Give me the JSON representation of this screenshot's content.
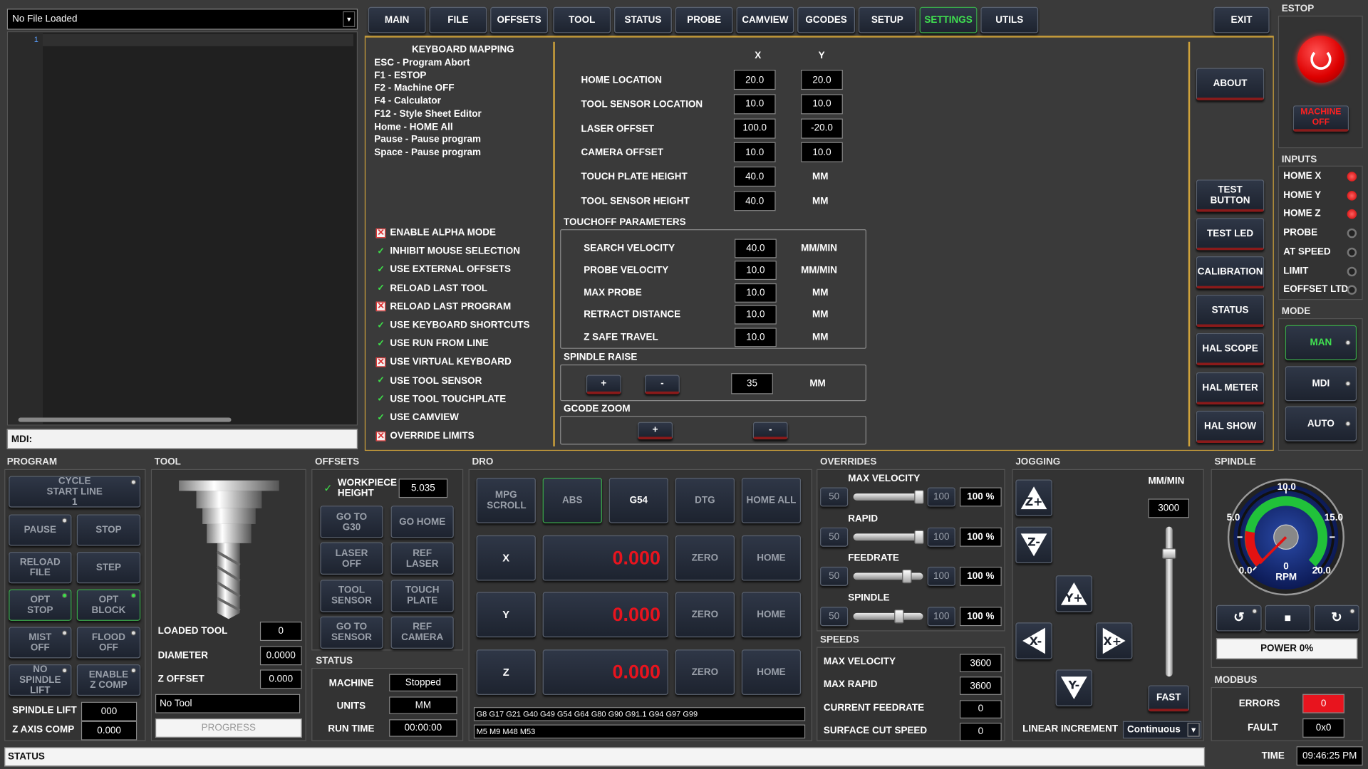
{
  "file_select": "No File Loaded",
  "editor": {
    "line_number": "1",
    "mdi_label": "MDI:"
  },
  "tabs": [
    "MAIN",
    "FILE",
    "OFFSETS",
    "TOOL",
    "STATUS",
    "PROBE",
    "CAMVIEW",
    "GCODES",
    "SETUP",
    "SETTINGS",
    "UTILS"
  ],
  "exit_label": "EXIT",
  "estop": {
    "title": "ESTOP",
    "machine_off": "MACHINE OFF"
  },
  "keyboard": {
    "title": "KEYBOARD MAPPING",
    "lines": [
      "ESC - Program Abort",
      "F1 - ESTOP",
      "F2 - Machine OFF",
      "F4 - Calculator",
      "F12 - Style Sheet Editor",
      "Home - HOME All",
      "Pause - Pause program",
      "Space - Pause program"
    ]
  },
  "options": [
    {
      "label": "ENABLE ALPHA MODE",
      "checked": false
    },
    {
      "label": "INHIBIT MOUSE SELECTION",
      "checked": true
    },
    {
      "label": "USE EXTERNAL OFFSETS",
      "checked": true
    },
    {
      "label": "RELOAD LAST TOOL",
      "checked": true
    },
    {
      "label": "RELOAD LAST PROGRAM",
      "checked": false
    },
    {
      "label": "USE KEYBOARD SHORTCUTS",
      "checked": true
    },
    {
      "label": "USE RUN FROM LINE",
      "checked": true
    },
    {
      "label": "USE VIRTUAL KEYBOARD",
      "checked": false
    },
    {
      "label": "USE TOOL SENSOR",
      "checked": true
    },
    {
      "label": "USE TOOL TOUCHPLATE",
      "checked": true
    },
    {
      "label": "USE CAMVIEW",
      "checked": true
    },
    {
      "label": "OVERRIDE LIMITS",
      "checked": false
    }
  ],
  "settings": {
    "col_x": "X",
    "col_y": "Y",
    "rows": [
      {
        "label": "HOME LOCATION",
        "x": "20.0",
        "y": "20.0"
      },
      {
        "label": "TOOL SENSOR LOCATION",
        "x": "10.0",
        "y": "10.0"
      },
      {
        "label": "LASER OFFSET",
        "x": "100.0",
        "y": "-20.0"
      },
      {
        "label": "CAMERA OFFSET",
        "x": "10.0",
        "y": "10.0"
      },
      {
        "label": "TOUCH PLATE HEIGHT",
        "x": "40.0",
        "y": "MM"
      },
      {
        "label": "TOOL SENSOR HEIGHT",
        "x": "40.0",
        "y": "MM"
      }
    ],
    "touchoff_title": "TOUCHOFF PARAMETERS",
    "touchoff": [
      {
        "label": "SEARCH VELOCITY",
        "value": "40.0",
        "unit": "MM/MIN"
      },
      {
        "label": "PROBE VELOCITY",
        "value": "10.0",
        "unit": "MM/MIN"
      },
      {
        "label": "MAX PROBE",
        "value": "10.0",
        "unit": "MM"
      },
      {
        "label": "RETRACT DISTANCE",
        "value": "10.0",
        "unit": "MM"
      },
      {
        "label": "Z SAFE TRAVEL",
        "value": "10.0",
        "unit": "MM"
      }
    ],
    "spindle_raise_title": "SPINDLE RAISE",
    "spindle_raise_plus": "+",
    "spindle_raise_minus": "-",
    "spindle_raise_value": "35",
    "spindle_raise_unit": "MM",
    "gcode_zoom_title": "GCODE ZOOM",
    "zoom_plus": "+",
    "zoom_minus": "-"
  },
  "side_buttons": [
    "ABOUT",
    "TEST BUTTON",
    "TEST LED",
    "CALIBRATION",
    "STATUS",
    "HAL SCOPE",
    "HAL METER",
    "HAL SHOW"
  ],
  "inputs": {
    "title": "INPUTS",
    "items": [
      "HOME X",
      "HOME Y",
      "HOME Z",
      "PROBE",
      "AT SPEED",
      "LIMIT",
      "EOFFSET LTD"
    ]
  },
  "mode": {
    "title": "MODE",
    "buttons": [
      "MAN",
      "MDI",
      "AUTO"
    ]
  },
  "program": {
    "title": "PROGRAM",
    "cycle_start": "CYCLE START LINE 1",
    "pause": "PAUSE",
    "stop": "STOP",
    "reload": "RELOAD FILE",
    "step": "STEP",
    "opt_stop": "OPT STOP",
    "opt_block": "OPT BLOCK",
    "mist": "MIST OFF",
    "flood": "FLOOD OFF",
    "no_spindle_lift": "NO SPINDLE LIFT",
    "enable_zcomp": "ENABLE Z COMP",
    "spindle_lift_label": "SPINDLE LIFT",
    "spindle_lift_value": "000",
    "zcomp_label": "Z AXIS COMP",
    "zcomp_value": "0.000"
  },
  "tool": {
    "title": "TOOL",
    "loaded_label": "LOADED TOOL",
    "loaded_value": "0",
    "diameter_label": "DIAMETER",
    "diameter_value": "0.0000",
    "zoffset_label": "Z OFFSET",
    "zoffset_value": "0.000",
    "description": "No Tool",
    "progress": "PROGRESS"
  },
  "offsets": {
    "title": "OFFSETS",
    "workpiece_label": "WORKPIECE HEIGHT",
    "workpiece_value": "5.035",
    "buttons": [
      "GO TO G30",
      "GO HOME",
      "LASER OFF",
      "REF LASER",
      "TOOL SENSOR",
      "TOUCH PLATE",
      "GO TO SENSOR",
      "REF CAMERA"
    ]
  },
  "status": {
    "title": "STATUS",
    "machine_label": "MACHINE",
    "machine_value": "Stopped",
    "units_label": "UNITS",
    "units_value": "MM",
    "runtime_label": "RUN TIME",
    "runtime_value": "00:00:00"
  },
  "dro": {
    "title": "DRO",
    "mpg": "MPG SCROLL",
    "abs": "ABS",
    "g54": "G54",
    "dtg": "DTG",
    "home_all": "HOME ALL",
    "axes": [
      {
        "name": "X",
        "value": "0.000"
      },
      {
        "name": "Y",
        "value": "0.000"
      },
      {
        "name": "Z",
        "value": "0.000"
      }
    ],
    "zero": "ZERO",
    "home": "HOME",
    "gcodes": "G8 G17 G21 G40 G49 G54 G64 G80 G90 G91.1 G94 G97 G99",
    "mcodes": "M5 M9 M48 M53"
  },
  "overrides": {
    "title": "OVERRIDES",
    "items": [
      {
        "label": "MAX VELOCITY",
        "min": "50",
        "max": "100",
        "value": "100 %",
        "level": 1.0
      },
      {
        "label": "RAPID",
        "min": "50",
        "max": "100",
        "value": "100 %",
        "level": 1.0
      },
      {
        "label": "FEEDRATE",
        "min": "50",
        "max": "100",
        "value": "100 %",
        "level": 0.8
      },
      {
        "label": "SPINDLE",
        "min": "50",
        "max": "100",
        "value": "100 %",
        "level": 0.67
      }
    ]
  },
  "speeds": {
    "title": "SPEEDS",
    "items": [
      {
        "label": "MAX VELOCITY",
        "value": "3600"
      },
      {
        "label": "MAX RAPID",
        "value": "3600"
      },
      {
        "label": "CURRENT FEEDRATE",
        "value": "0"
      },
      {
        "label": "SURFACE CUT SPEED",
        "value": "0"
      }
    ]
  },
  "jogging": {
    "title": "JOGGING",
    "unit": "MM/MIN",
    "rate": "3000",
    "fast": "FAST",
    "increment_label": "LINEAR INCREMENT",
    "increment_value": "Continuous"
  },
  "spindle": {
    "title": "SPINDLE",
    "gauge_labels": [
      "10.0",
      "5.0",
      "15.0",
      "0.0",
      "20.0"
    ],
    "rpm": "0",
    "rpm_label": "RPM",
    "power": "POWER 0%"
  },
  "modbus": {
    "title": "MODBUS",
    "errors_label": "ERRORS",
    "errors_value": "0",
    "fault_label": "FAULT",
    "fault_value": "0x0"
  },
  "statusbar": {
    "label": "STATUS",
    "time_label": "TIME",
    "time_value": "09:46:25 PM"
  },
  "colors": {
    "accent": "#cfa23a",
    "active": "#40e050",
    "alert": "#e8141e",
    "dro": "#e8141e"
  }
}
